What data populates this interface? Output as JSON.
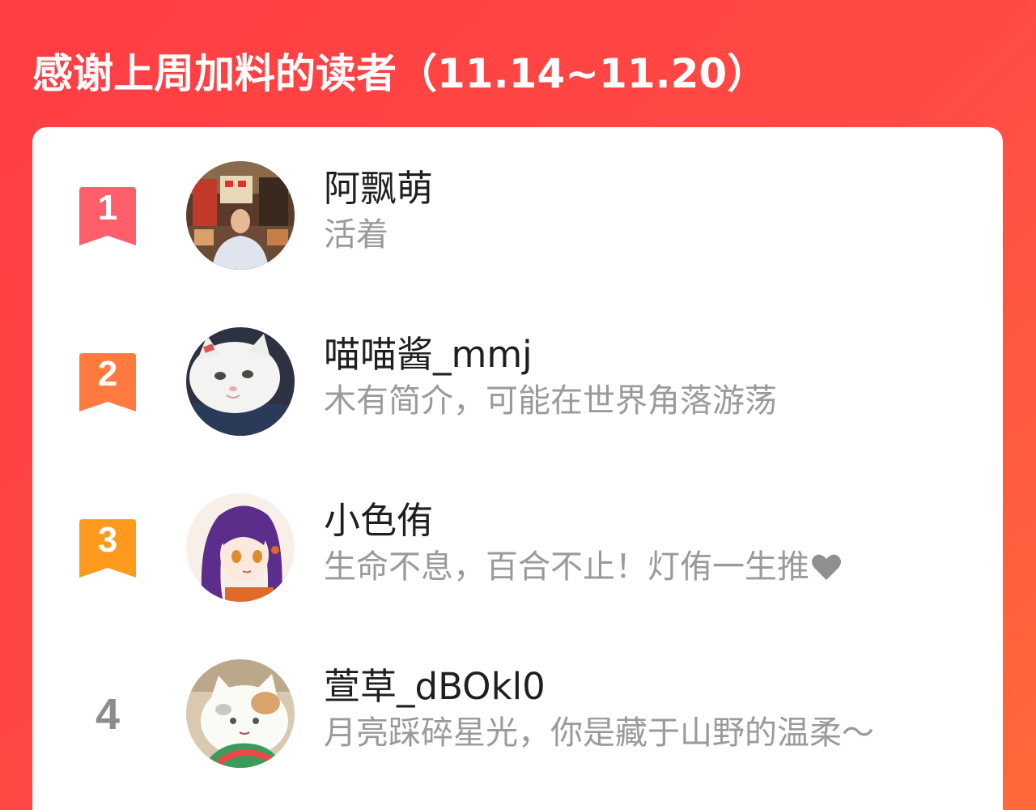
{
  "header": {
    "title": "感谢上周加料的读者（11.14~11.20）"
  },
  "colors": {
    "background_start": "#ff3d44",
    "background_end": "#ff6a3a",
    "rank1": "#ff5f6a",
    "rank2": "#ff7a3f",
    "rank3": "#ff9a1e",
    "rank_plain": "#8c8c8c",
    "name_text": "#1f1f1f",
    "bio_text": "#9a9a9a"
  },
  "readers": [
    {
      "rank": "1",
      "name": "阿飘萌",
      "bio": "活着",
      "avatar_icon": "person-photo-avatar"
    },
    {
      "rank": "2",
      "name": "喵喵酱_mmj",
      "bio": "木有简介，可能在世界角落游荡",
      "avatar_icon": "white-cat-avatar"
    },
    {
      "rank": "3",
      "name": "小色侑",
      "bio": "生命不息，百合不止！灯侑一生推",
      "bio_icon": "heart-icon",
      "avatar_icon": "anime-girl-avatar"
    },
    {
      "rank": "4",
      "name": "萱草_dBOkl0",
      "bio": "月亮踩碎星光，你是藏于山野的温柔～",
      "avatar_icon": "cat-sensei-avatar"
    }
  ]
}
